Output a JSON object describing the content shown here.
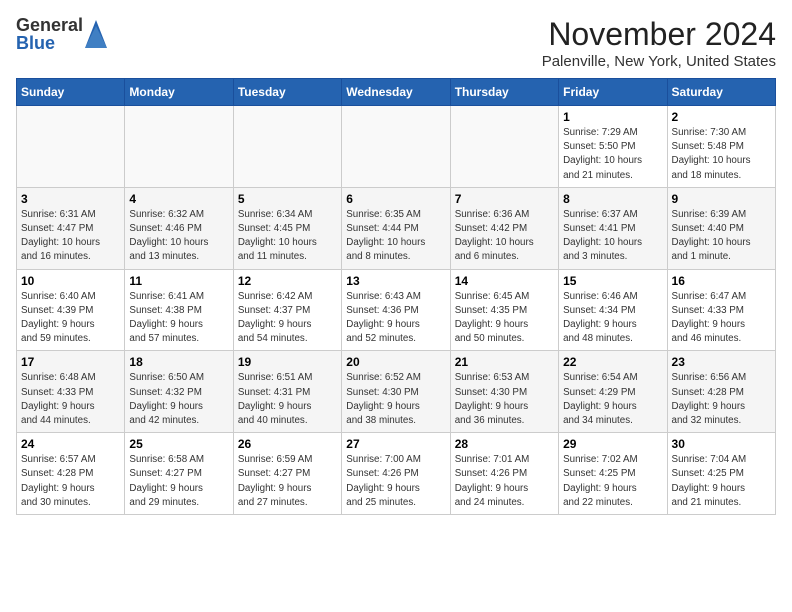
{
  "header": {
    "logo_general": "General",
    "logo_blue": "Blue",
    "month_title": "November 2024",
    "location": "Palenville, New York, United States"
  },
  "calendar": {
    "days_of_week": [
      "Sunday",
      "Monday",
      "Tuesday",
      "Wednesday",
      "Thursday",
      "Friday",
      "Saturday"
    ],
    "weeks": [
      [
        {
          "day": "",
          "info": ""
        },
        {
          "day": "",
          "info": ""
        },
        {
          "day": "",
          "info": ""
        },
        {
          "day": "",
          "info": ""
        },
        {
          "day": "",
          "info": ""
        },
        {
          "day": "1",
          "info": "Sunrise: 7:29 AM\nSunset: 5:50 PM\nDaylight: 10 hours\nand 21 minutes."
        },
        {
          "day": "2",
          "info": "Sunrise: 7:30 AM\nSunset: 5:48 PM\nDaylight: 10 hours\nand 18 minutes."
        }
      ],
      [
        {
          "day": "3",
          "info": "Sunrise: 6:31 AM\nSunset: 4:47 PM\nDaylight: 10 hours\nand 16 minutes."
        },
        {
          "day": "4",
          "info": "Sunrise: 6:32 AM\nSunset: 4:46 PM\nDaylight: 10 hours\nand 13 minutes."
        },
        {
          "day": "5",
          "info": "Sunrise: 6:34 AM\nSunset: 4:45 PM\nDaylight: 10 hours\nand 11 minutes."
        },
        {
          "day": "6",
          "info": "Sunrise: 6:35 AM\nSunset: 4:44 PM\nDaylight: 10 hours\nand 8 minutes."
        },
        {
          "day": "7",
          "info": "Sunrise: 6:36 AM\nSunset: 4:42 PM\nDaylight: 10 hours\nand 6 minutes."
        },
        {
          "day": "8",
          "info": "Sunrise: 6:37 AM\nSunset: 4:41 PM\nDaylight: 10 hours\nand 3 minutes."
        },
        {
          "day": "9",
          "info": "Sunrise: 6:39 AM\nSunset: 4:40 PM\nDaylight: 10 hours\nand 1 minute."
        }
      ],
      [
        {
          "day": "10",
          "info": "Sunrise: 6:40 AM\nSunset: 4:39 PM\nDaylight: 9 hours\nand 59 minutes."
        },
        {
          "day": "11",
          "info": "Sunrise: 6:41 AM\nSunset: 4:38 PM\nDaylight: 9 hours\nand 57 minutes."
        },
        {
          "day": "12",
          "info": "Sunrise: 6:42 AM\nSunset: 4:37 PM\nDaylight: 9 hours\nand 54 minutes."
        },
        {
          "day": "13",
          "info": "Sunrise: 6:43 AM\nSunset: 4:36 PM\nDaylight: 9 hours\nand 52 minutes."
        },
        {
          "day": "14",
          "info": "Sunrise: 6:45 AM\nSunset: 4:35 PM\nDaylight: 9 hours\nand 50 minutes."
        },
        {
          "day": "15",
          "info": "Sunrise: 6:46 AM\nSunset: 4:34 PM\nDaylight: 9 hours\nand 48 minutes."
        },
        {
          "day": "16",
          "info": "Sunrise: 6:47 AM\nSunset: 4:33 PM\nDaylight: 9 hours\nand 46 minutes."
        }
      ],
      [
        {
          "day": "17",
          "info": "Sunrise: 6:48 AM\nSunset: 4:33 PM\nDaylight: 9 hours\nand 44 minutes."
        },
        {
          "day": "18",
          "info": "Sunrise: 6:50 AM\nSunset: 4:32 PM\nDaylight: 9 hours\nand 42 minutes."
        },
        {
          "day": "19",
          "info": "Sunrise: 6:51 AM\nSunset: 4:31 PM\nDaylight: 9 hours\nand 40 minutes."
        },
        {
          "day": "20",
          "info": "Sunrise: 6:52 AM\nSunset: 4:30 PM\nDaylight: 9 hours\nand 38 minutes."
        },
        {
          "day": "21",
          "info": "Sunrise: 6:53 AM\nSunset: 4:30 PM\nDaylight: 9 hours\nand 36 minutes."
        },
        {
          "day": "22",
          "info": "Sunrise: 6:54 AM\nSunset: 4:29 PM\nDaylight: 9 hours\nand 34 minutes."
        },
        {
          "day": "23",
          "info": "Sunrise: 6:56 AM\nSunset: 4:28 PM\nDaylight: 9 hours\nand 32 minutes."
        }
      ],
      [
        {
          "day": "24",
          "info": "Sunrise: 6:57 AM\nSunset: 4:28 PM\nDaylight: 9 hours\nand 30 minutes."
        },
        {
          "day": "25",
          "info": "Sunrise: 6:58 AM\nSunset: 4:27 PM\nDaylight: 9 hours\nand 29 minutes."
        },
        {
          "day": "26",
          "info": "Sunrise: 6:59 AM\nSunset: 4:27 PM\nDaylight: 9 hours\nand 27 minutes."
        },
        {
          "day": "27",
          "info": "Sunrise: 7:00 AM\nSunset: 4:26 PM\nDaylight: 9 hours\nand 25 minutes."
        },
        {
          "day": "28",
          "info": "Sunrise: 7:01 AM\nSunset: 4:26 PM\nDaylight: 9 hours\nand 24 minutes."
        },
        {
          "day": "29",
          "info": "Sunrise: 7:02 AM\nSunset: 4:25 PM\nDaylight: 9 hours\nand 22 minutes."
        },
        {
          "day": "30",
          "info": "Sunrise: 7:04 AM\nSunset: 4:25 PM\nDaylight: 9 hours\nand 21 minutes."
        }
      ]
    ]
  }
}
